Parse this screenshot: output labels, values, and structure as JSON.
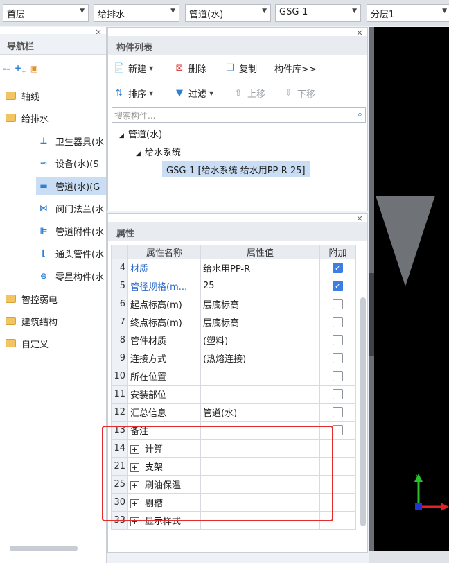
{
  "toolbar": {
    "floor": "首层",
    "discipline": "给排水",
    "type": "管道(水)",
    "component": "GSG-1",
    "layer": "分层1"
  },
  "nav": {
    "title": "导航栏",
    "close": "×",
    "tool_icons": [
      "collapse-icon",
      "expand-icon",
      "edit-icon"
    ],
    "items": [
      {
        "label": "轴线",
        "icon": "folder-icon"
      },
      {
        "label": "给排水",
        "icon": "folder-open-icon"
      },
      {
        "label": "卫生器具(水",
        "icon": "sanitary-fixture-icon"
      },
      {
        "label": "设备(水)(S",
        "icon": "equipment-icon"
      },
      {
        "label": "管道(水)(G",
        "icon": "pipe-icon"
      },
      {
        "label": "阀门法兰(水",
        "icon": "valve-icon"
      },
      {
        "label": "管道附件(水",
        "icon": "pipe-accessory-icon"
      },
      {
        "label": "通头管件(水",
        "icon": "fitting-icon"
      },
      {
        "label": "零星构件(水",
        "icon": "misc-component-icon"
      },
      {
        "label": "智控弱电",
        "icon": "folder-icon"
      },
      {
        "label": "建筑结构",
        "icon": "folder-icon"
      },
      {
        "label": "自定义",
        "icon": "folder-icon"
      }
    ]
  },
  "component_list": {
    "title": "构件列表",
    "close": "×",
    "new": "新建",
    "delete": "删除",
    "copy": "复制",
    "library": "构件库>>",
    "sort": "排序",
    "filter": "过滤",
    "move_up": "上移",
    "move_down": "下移",
    "search_placeholder": "搜索构件...",
    "tree": {
      "root": "管道(水)",
      "system": "给水系统",
      "selected": "GSG-1 [给水系统 给水用PP-R 25]"
    }
  },
  "properties": {
    "title": "属性",
    "close": "×",
    "headers": {
      "name": "属性名称",
      "value": "属性值",
      "extra": "附加"
    },
    "rows": [
      {
        "num": "4",
        "name": "材质",
        "value": "给水用PP-R",
        "checked": true,
        "blue": true
      },
      {
        "num": "5",
        "name": "管径规格(m...",
        "value": "25",
        "checked": true,
        "blue": true
      },
      {
        "num": "6",
        "name": "起点标高(m)",
        "value": "层底标高",
        "checked": false
      },
      {
        "num": "7",
        "name": "终点标高(m)",
        "value": "层底标高",
        "checked": false
      },
      {
        "num": "8",
        "name": "管件材质",
        "value": "(塑料)",
        "checked": false
      },
      {
        "num": "9",
        "name": "连接方式",
        "value": "(热熔连接)",
        "checked": false
      },
      {
        "num": "10",
        "name": "所在位置",
        "value": "",
        "checked": false
      },
      {
        "num": "11",
        "name": "安装部位",
        "value": "",
        "checked": false
      },
      {
        "num": "12",
        "name": "汇总信息",
        "value": "管道(水)",
        "checked": false
      },
      {
        "num": "13",
        "name": "备注",
        "value": "",
        "checked": false
      },
      {
        "num": "14",
        "name": "计算",
        "value": "",
        "group": true
      },
      {
        "num": "21",
        "name": "支架",
        "value": "",
        "group": true
      },
      {
        "num": "25",
        "name": "刷油保温",
        "value": "",
        "group": true
      },
      {
        "num": "30",
        "name": "剔槽",
        "value": "",
        "group": true
      },
      {
        "num": "33",
        "name": "显示样式",
        "value": "",
        "group": true
      }
    ]
  },
  "canvas": {
    "y_axis_label": "Y",
    "colors": {
      "background": "#000000",
      "triangle": "#6f7378",
      "axis_y": "#27c227",
      "axis_x": "#e62020"
    }
  },
  "highlight": {
    "color": "#e52c2c"
  }
}
